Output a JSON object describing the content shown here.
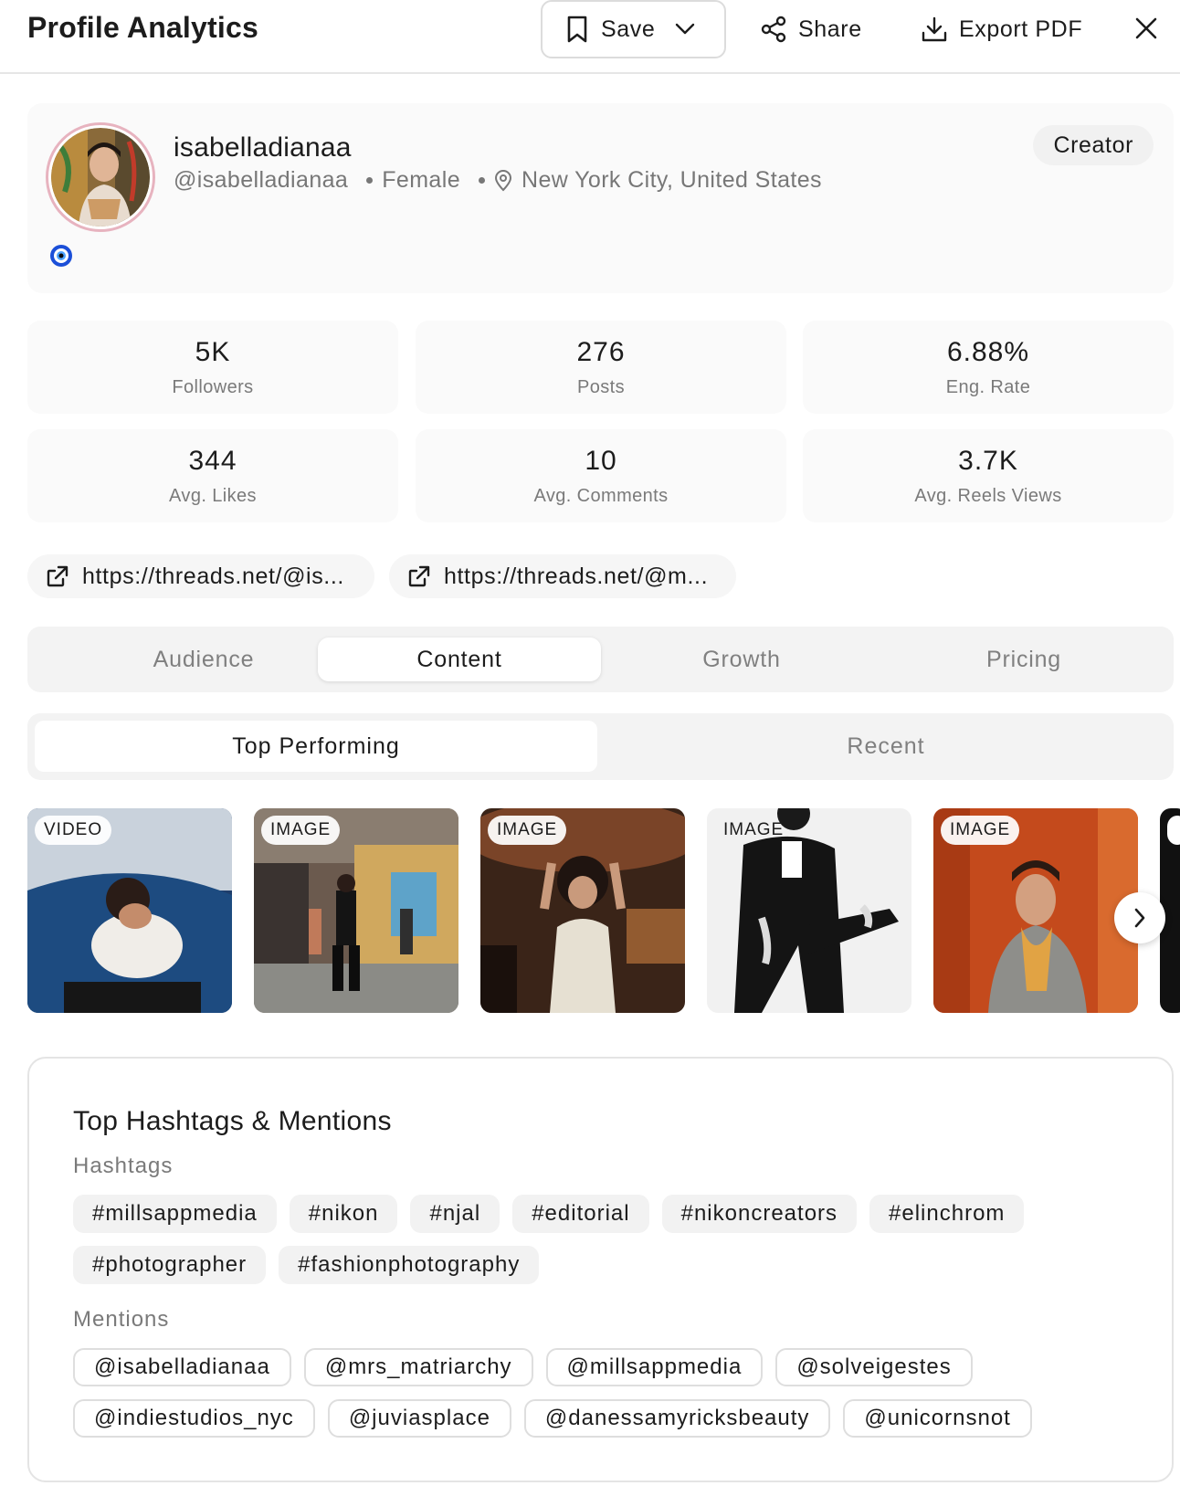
{
  "header": {
    "title": "Profile Analytics",
    "save_label": "Save",
    "share_label": "Share",
    "export_label": "Export PDF"
  },
  "profile": {
    "name": "isabelladianaa",
    "handle": "@isabelladianaa",
    "gender": "Female",
    "location": "New York City, United States",
    "badge": "Creator",
    "ring_color": "#e7b3bf"
  },
  "stats": [
    {
      "value": "5K",
      "label": "Followers"
    },
    {
      "value": "276",
      "label": "Posts"
    },
    {
      "value": "6.88%",
      "label": "Eng. Rate"
    },
    {
      "value": "344",
      "label": "Avg. Likes"
    },
    {
      "value": "10",
      "label": "Avg. Comments"
    },
    {
      "value": "3.7K",
      "label": "Avg. Reels Views"
    }
  ],
  "links": [
    "https://threads.net/@is...",
    "https://threads.net/@m..."
  ],
  "tabs": [
    "Audience",
    "Content",
    "Growth",
    "Pricing"
  ],
  "active_tab": "Content",
  "subtabs": [
    "Top Performing",
    "Recent"
  ],
  "active_subtab": "Top Performing",
  "media": [
    {
      "type": "VIDEO"
    },
    {
      "type": "IMAGE"
    },
    {
      "type": "IMAGE"
    },
    {
      "type": "IMAGE"
    },
    {
      "type": "IMAGE"
    }
  ],
  "hashtags_section": {
    "title": "Top Hashtags & Mentions",
    "hashtags_label": "Hashtags",
    "hashtags": [
      "#millsappmedia",
      "#nikon",
      "#njal",
      "#editorial",
      "#nikoncreators",
      "#elinchrom",
      "#photographer",
      "#fashionphotography"
    ],
    "mentions_label": "Mentions",
    "mentions": [
      "@isabelladianaa",
      "@mrs_matriarchy",
      "@millsappmedia",
      "@solveigestes",
      "@indiestudios_nyc",
      "@juviasplace",
      "@danessamyricksbeauty",
      "@unicornsnot"
    ]
  }
}
